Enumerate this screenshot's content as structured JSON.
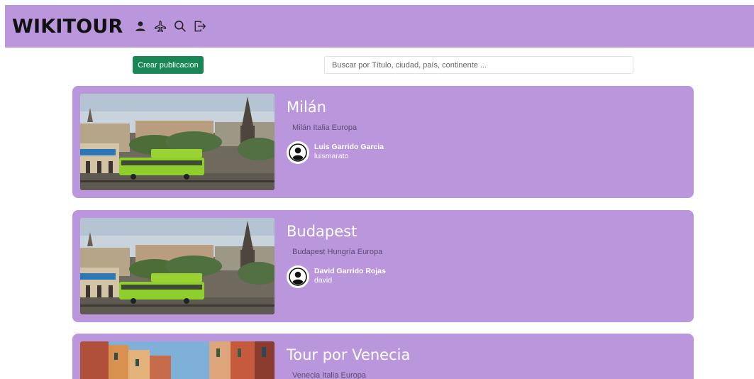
{
  "navbar": {
    "brand": "WIKITOUR",
    "icons": [
      "user-icon",
      "airplane-icon",
      "search-icon",
      "logout-icon"
    ],
    "background": "#ba97dd"
  },
  "toolbar": {
    "create_label": "Crear publicacion",
    "search_placeholder": "Buscar por Título, ciudad, país, continente ..."
  },
  "posts": [
    {
      "title": "Milán",
      "location": "Milán Italia Europa",
      "author_name": "Luis Garrido Garcia",
      "author_user": "luismarato"
    },
    {
      "title": "Budapest",
      "location": "Budapest Hungría Europa",
      "author_name": "David Garrido Rojas",
      "author_user": "david"
    },
    {
      "title": "Tour por Venecia",
      "location": "Venecia Italia Europa"
    }
  ],
  "colors": {
    "accent": "#ba97dd",
    "button": "#198754"
  }
}
